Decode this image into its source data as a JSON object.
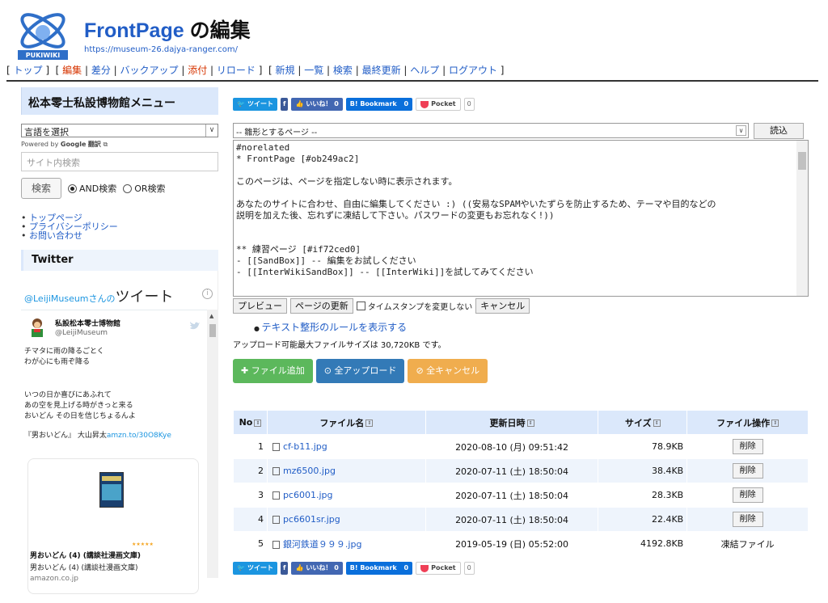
{
  "header": {
    "title_main": "FrontPage",
    "title_suffix": " の編集",
    "url": "https://museum-26.dajya-ranger.com/",
    "logo_text": "PUKIWIKI"
  },
  "nav": {
    "top": "トップ",
    "edit": "編集",
    "diff": "差分",
    "backup": "バックアップ",
    "attach": "添付",
    "reload": "リロード",
    "new": "新規",
    "list": "一覧",
    "search": "検索",
    "recent": "最終更新",
    "help": "ヘルプ",
    "logout": "ログアウト"
  },
  "sidebar": {
    "menu_title": "松本零士私設博物館メニュー",
    "lang_select": "言語を選択",
    "powered_prefix": "Powered by ",
    "google": "Google",
    "translate": "翻訳",
    "search_placeholder": "サイト内検索",
    "search_button": "検索",
    "and_label": "AND検索",
    "or_label": "OR検索",
    "links": [
      "トップページ",
      "プライバシーポリシー",
      "お問い合わせ"
    ],
    "twitter_title": "Twitter"
  },
  "tweet": {
    "account": "@LeijiMuseumさんの",
    "heading": "ツイート",
    "info": "i",
    "name": "私設松本零士博物館",
    "handle": "@LeijiMuseum",
    "body1": "チマタに雨の降るごとく\nわが心にも雨ぞ降る",
    "body2": "いつの日か喜びにあふれて\nあの空を見上げる時がきっと来る\nおいどん その日を信じちょるんよ",
    "foot_text": "『男おいどん』 大山昇太",
    "foot_link": "amzn.to/30O8Kye",
    "card_title": "男おいどん (4) (講談社漫画文庫)",
    "card_sub": "男おいどん (4) (講談社漫画文庫)",
    "card_src": "amazon.co.jp",
    "stars": "★★★★★"
  },
  "share": {
    "tweet": "ツイート",
    "like": "いいね！ 0",
    "hatena": "B! Bookmark",
    "hatena_count": "0",
    "pocket": "Pocket",
    "pocket_count": "0"
  },
  "editor": {
    "template_select": "-- 雛形とするページ --",
    "read_button": "読込",
    "content": "#norelated\n* FrontPage [#ob249ac2]\n\nこのページは、ページを指定しない時に表示されます。\n\nあなたのサイトに合わせ、自由に編集してください :) ((安易なSPAMやいたずらを防止するため、テーマや目的などの\n説明を加えた後、忘れずに凍結して下さい。パスワードの変更もお忘れなく!))\n\n\n** 練習ページ [#if72ced0]\n- [[SandBox]] -- 編集をお試しください\n- [[InterWikiSandBox]] -- [[InterWiki]]を試してみてください",
    "preview": "プレビュー",
    "update": "ページの更新",
    "timestamp": "タイムスタンプを変更しない",
    "cancel": "キャンセル",
    "rules_link": "テキスト整形のルールを表示する",
    "max_size": "アップロード可能最大ファイルサイズは 30,720KB です。"
  },
  "upload": {
    "add": "ファイル追加",
    "all_upload": "全アップロード",
    "all_cancel": "全キャンセル"
  },
  "files": {
    "headers": [
      "No",
      "ファイル名",
      "更新日時",
      "サイズ",
      "ファイル操作"
    ],
    "rows": [
      {
        "no": "1",
        "name": "cf-b11.jpg",
        "date": "2020-08-10 (月) 09:51:42",
        "size": "78.9KB",
        "op": "削除"
      },
      {
        "no": "2",
        "name": "mz6500.jpg",
        "date": "2020-07-11 (土) 18:50:04",
        "size": "38.4KB",
        "op": "削除"
      },
      {
        "no": "3",
        "name": "pc6001.jpg",
        "date": "2020-07-11 (土) 18:50:04",
        "size": "28.3KB",
        "op": "削除"
      },
      {
        "no": "4",
        "name": "pc6601sr.jpg",
        "date": "2020-07-11 (土) 18:50:04",
        "size": "22.4KB",
        "op": "削除"
      },
      {
        "no": "5",
        "name": "銀河鉄道９９９.jpg",
        "date": "2019-05-19 (日) 05:52:00",
        "size": "4192.8KB",
        "op": "凍結ファイル"
      }
    ]
  },
  "colors": {
    "link": "#215dc6",
    "menu_bg": "#dbe8fb",
    "green": "#5cb85c",
    "blue": "#337ab7",
    "orange": "#f0ad4e"
  }
}
